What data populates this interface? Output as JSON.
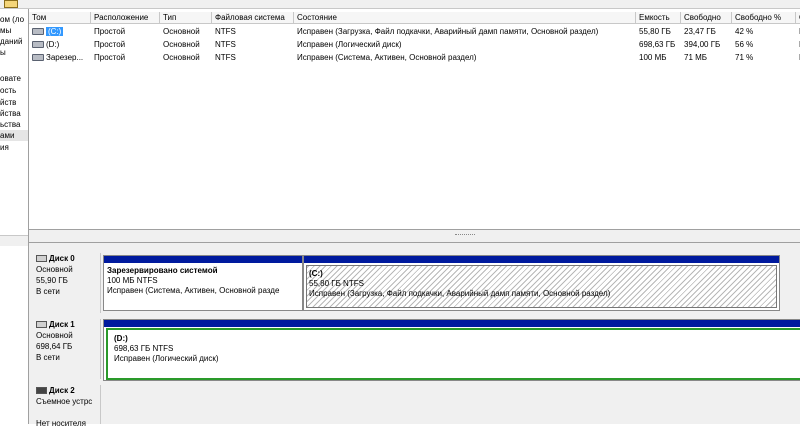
{
  "tree": {
    "items": [
      {
        "label": "ом (ло"
      },
      {
        "label": "мы"
      },
      {
        "label": "даний"
      },
      {
        "label": "ы"
      },
      {
        "label": ""
      },
      {
        "label": "овате"
      },
      {
        "label": "ость"
      },
      {
        "label": "йств"
      },
      {
        "label": "йства"
      },
      {
        "label": "ьства"
      },
      {
        "label": "ами"
      },
      {
        "label": "ия"
      }
    ]
  },
  "volumes": {
    "columns": [
      "Том",
      "Расположение",
      "Тип",
      "Файловая система",
      "Состояние",
      "Емкость",
      "Свободно",
      "Свободно %",
      "О"
    ],
    "rows": [
      {
        "name": "(C:)",
        "layout": "Простой",
        "type": "Основной",
        "fs": "NTFS",
        "status": "Исправен (Загрузка, Файл подкачки, Аварийный дамп памяти, Основной раздел)",
        "capacity": "55,80 ГБ",
        "free": "23,47 ГБ",
        "free_pct": "42 %",
        "extra": "Н"
      },
      {
        "name": "(D:)",
        "layout": "Простой",
        "type": "Основной",
        "fs": "NTFS",
        "status": "Исправен (Логический диск)",
        "capacity": "698,63 ГБ",
        "free": "394,00 ГБ",
        "free_pct": "56 %",
        "extra": "Н"
      },
      {
        "name": "Зарезер...",
        "layout": "Простой",
        "type": "Основной",
        "fs": "NTFS",
        "status": "Исправен (Система, Активен, Основной раздел)",
        "capacity": "100 МБ",
        "free": "71 МБ",
        "free_pct": "71 %",
        "extra": "Н"
      }
    ]
  },
  "disks": [
    {
      "name": "Диск 0",
      "kind": "Основной",
      "size": "55,90 ГБ",
      "state": "В сети",
      "partitions": [
        {
          "title": "Зарезервировано системой",
          "size": "100 МБ NTFS",
          "status": "Исправен (Система, Активен, Основной разде"
        },
        {
          "title": "(C:)",
          "size": "55,80 ГБ NTFS",
          "status": "Исправен (Загрузка, Файл подкачки, Аварийный дамп памяти, Основной раздел)"
        }
      ]
    },
    {
      "name": "Диск 1",
      "kind": "Основной",
      "size": "698,64 ГБ",
      "state": "В сети",
      "partitions": [
        {
          "title": "(D:)",
          "size": "698,63 ГБ NTFS",
          "status": "Исправен (Логический диск)"
        }
      ]
    },
    {
      "name": "Диск 2",
      "kind": "Съемное устрс",
      "size": "",
      "state": "Нет носителя",
      "partitions": []
    }
  ],
  "colors": {
    "primary_bar": "#001a9e",
    "selection": "#3399ff",
    "logical_frame": "#2a9a2a"
  },
  "icons": {
    "volume": "drive-volume-icon",
    "disk": "hard-disk-icon",
    "removable": "removable-disk-icon"
  }
}
